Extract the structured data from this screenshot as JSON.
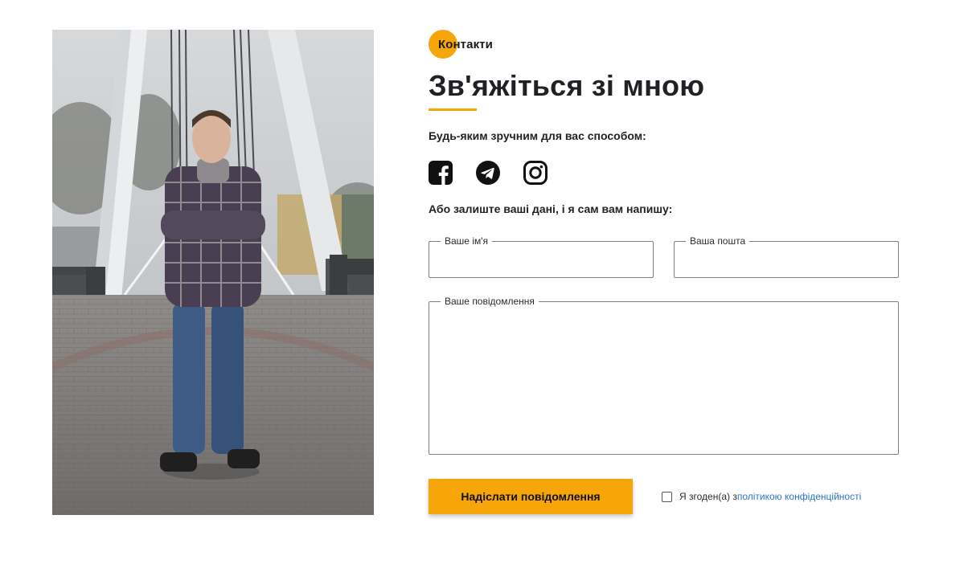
{
  "photo": {
    "alt": "Фото автора на мосту"
  },
  "contact": {
    "eyebrow": "Контакти",
    "heading": "Зв'яжіться зі мною",
    "lead_social": "Будь-яким зручним для вас способом:",
    "socials": [
      {
        "name": "facebook-icon"
      },
      {
        "name": "telegram-icon"
      },
      {
        "name": "instagram-icon"
      }
    ],
    "lead_form": "Або залиште ваші дані, і я сам вам напишу:",
    "form": {
      "name_label": "Ваше ім'я",
      "name_value": "",
      "email_label": "Ваша пошта",
      "email_value": "",
      "message_label": "Ваше повідомлення",
      "message_value": "",
      "submit_label": "Надіслати повідомлення",
      "consent_prefix": "Я згоден(а) з ",
      "consent_link": "політикою конфіденційності"
    }
  },
  "colors": {
    "accent": "#f6a609",
    "link": "#2d73c9",
    "text": "#1f2125"
  }
}
